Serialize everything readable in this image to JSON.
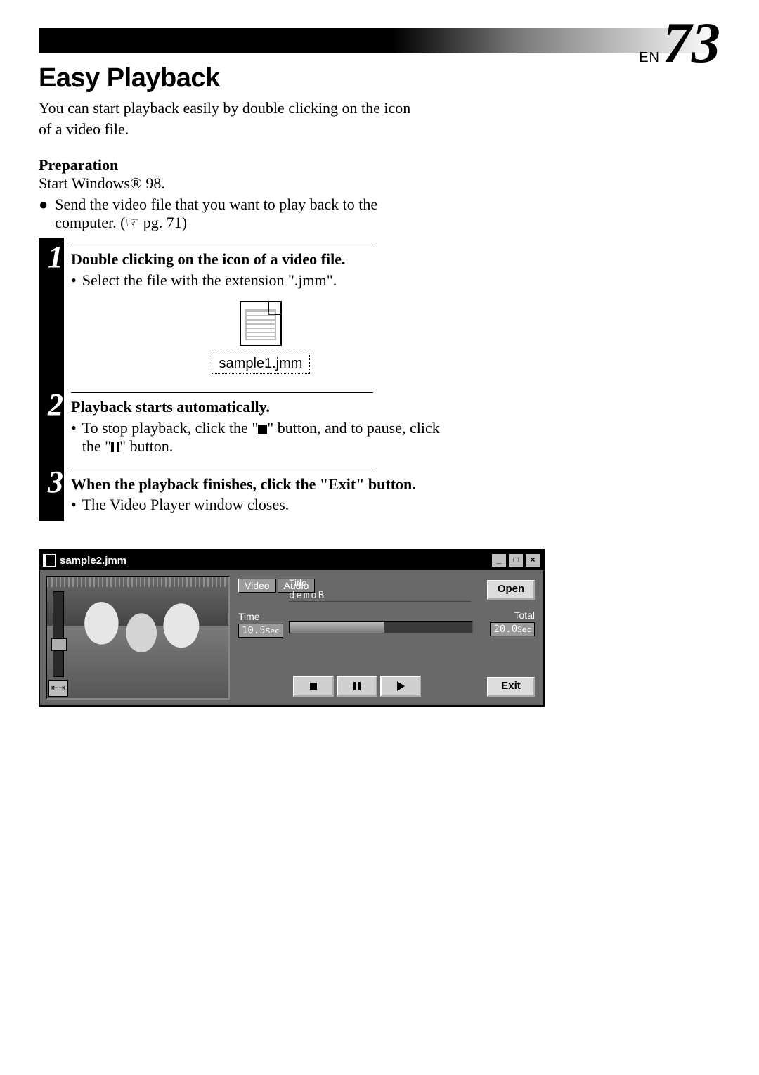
{
  "page_header": {
    "lang_label": "EN",
    "page_number": "73"
  },
  "section_title": "Easy Playback",
  "intro": "You can start playback easily by double clicking on the icon of a video file.",
  "preparation": {
    "heading": "Preparation",
    "line": "Start Windows® 98.",
    "bullet": "Send the video file that you want to play back to the computer. (☞ pg. 71)"
  },
  "steps": [
    {
      "num": "1",
      "head": "Double clicking on the icon of a video file.",
      "body": "Select the file with the extension \".jmm\".",
      "file_label": "sample1.jmm"
    },
    {
      "num": "2",
      "head": "Playback starts automatically.",
      "body_pre": "To stop playback, click the \"",
      "body_mid": "\" button, and to pause, click the \"",
      "body_post": "\" button."
    },
    {
      "num": "3",
      "head": "When the playback finishes, click the \"Exit\" button.",
      "body": "The Video Player window closes."
    }
  ],
  "player": {
    "window_title": "sample2.jmm",
    "tabs": {
      "video": "Video",
      "audio": "Audio"
    },
    "title_label": "Title",
    "title_value": "demoB",
    "open": "Open",
    "time_label": "Time",
    "time_value": "10.5",
    "time_suffix": "Sec",
    "total_label": "Total",
    "total_value": "20.0",
    "total_suffix": "Sec",
    "exit": "Exit",
    "window_buttons": {
      "min": "_",
      "max": "□",
      "close": "×"
    },
    "aux_icon": "⇤⇥"
  }
}
